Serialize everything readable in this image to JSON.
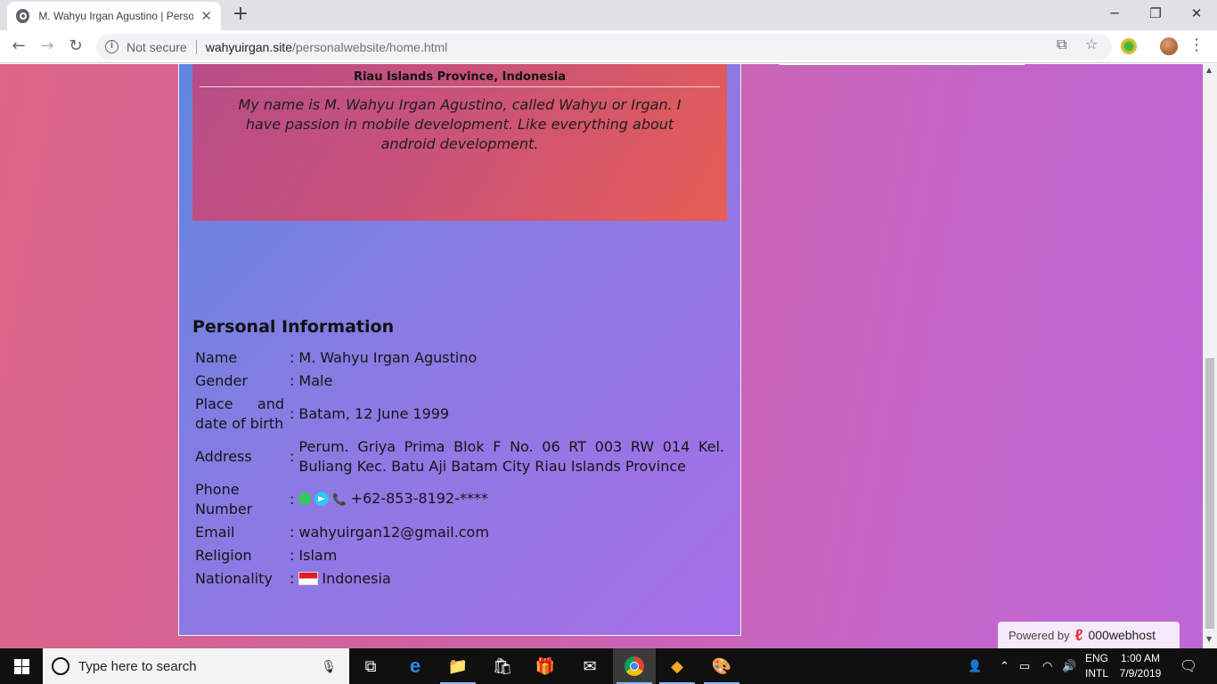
{
  "browser": {
    "tab_title": "M. Wahyu Irgan Agustino | Perso",
    "new_tab": "+",
    "security_label": "Not secure",
    "url_host": "wahyuirgan.site",
    "url_path": "/personalwebsite/home.html",
    "window_controls": {
      "minimize": "─",
      "restore": "❐",
      "close": "✕"
    }
  },
  "profile": {
    "location": "Riau Islands Province, Indonesia",
    "bio": "My name is M. Wahyu Irgan Agustino, called Wahyu or Irgan. I have passion in mobile development. Like everything about android development."
  },
  "personal_info": {
    "title": "Personal Information",
    "rows": [
      {
        "label": "Name",
        "value": "M. Wahyu Irgan Agustino"
      },
      {
        "label": "Gender",
        "value": "Male"
      },
      {
        "label": "Place and date of birth",
        "value": "Batam, 12 June 1999"
      },
      {
        "label": "Address",
        "value": "Perum. Griya Prima Blok F No. 06 RT 003 RW 014 Kel. Buliang Kec. Batu Aji Batam City Riau Islands Province"
      },
      {
        "label": "Phone Number",
        "value": "+62-853-8192-****"
      },
      {
        "label": "Email",
        "value": "wahyuirgan12@gmail.com"
      },
      {
        "label": "Religion",
        "value": "Islam"
      },
      {
        "label": "Nationality",
        "value": "Indonesia"
      }
    ],
    "separator": ":"
  },
  "powered_badge": {
    "prefix": "Powered by",
    "brand": "000webhost"
  },
  "taskbar": {
    "search_placeholder": "Type here to search",
    "language_top": "ENG",
    "language_bottom": "INTL",
    "time": "1:00 AM",
    "date": "7/9/2019"
  },
  "colors": {
    "page_gradient_start": "#dd6586",
    "page_gradient_end": "#c067d8",
    "card_gradient_start": "#5f86df",
    "card_gradient_end": "#a76ee8",
    "profile_gradient_start": "#b84c88",
    "profile_gradient_end": "#e65d55",
    "whatsapp_green": "#34c759",
    "telegram_blue": "#2ec9f0"
  }
}
